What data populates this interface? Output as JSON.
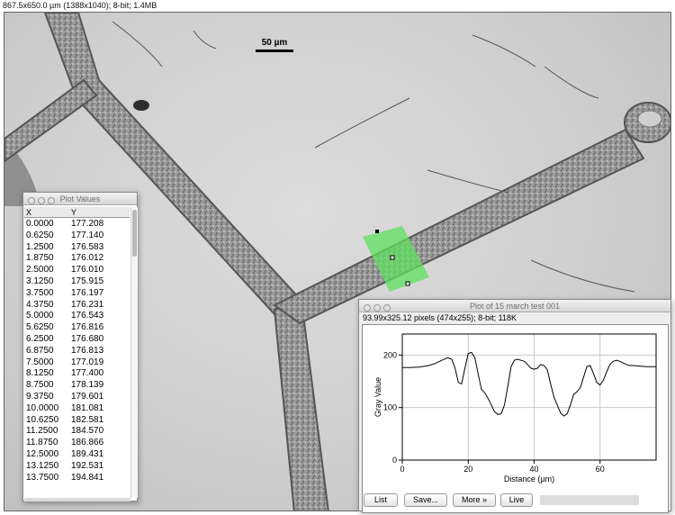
{
  "main_window": {
    "info": "867.5x650.0 µm (1388x1040); 8-bit; 1.4MB",
    "scale_bar_label": "50 µm"
  },
  "plot_values_window": {
    "title": "Plot Values",
    "columns": [
      "X",
      "Y"
    ],
    "rows": [
      [
        "0.0000",
        "177.208"
      ],
      [
        "0.6250",
        "177.140"
      ],
      [
        "1.2500",
        "176.583"
      ],
      [
        "1.8750",
        "176.012"
      ],
      [
        "2.5000",
        "176.010"
      ],
      [
        "3.1250",
        "175.915"
      ],
      [
        "3.7500",
        "176.197"
      ],
      [
        "4.3750",
        "176.231"
      ],
      [
        "5.0000",
        "176.543"
      ],
      [
        "5.6250",
        "176.816"
      ],
      [
        "6.2500",
        "176.680"
      ],
      [
        "6.8750",
        "176.813"
      ],
      [
        "7.5000",
        "177.019"
      ],
      [
        "8.1250",
        "177.400"
      ],
      [
        "8.7500",
        "178.139"
      ],
      [
        "9.3750",
        "179.601"
      ],
      [
        "10.0000",
        "181.081"
      ],
      [
        "10.6250",
        "182.581"
      ],
      [
        "11.2500",
        "184.570"
      ],
      [
        "11.8750",
        "186.866"
      ],
      [
        "12.5000",
        "189.431"
      ],
      [
        "13.1250",
        "192.531"
      ],
      [
        "13.7500",
        "194.841"
      ]
    ]
  },
  "plot_window": {
    "title": "Plot of 15 march  test 001",
    "info": "93.99x325.12 pixels (474x255); 8-bit; 118K",
    "buttons": {
      "list": "List",
      "save": "Save...",
      "more": "More »",
      "live": "Live"
    }
  },
  "chart_data": {
    "type": "line",
    "title": "",
    "xlabel": "Distance (µm)",
    "ylabel": "Gray Value",
    "xlim": [
      0,
      77
    ],
    "ylim": [
      0,
      240
    ],
    "xticks": [
      0,
      20,
      40,
      60
    ],
    "yticks": [
      0,
      100,
      200
    ],
    "grid": true,
    "series": [
      {
        "x": [
          0,
          2,
          5,
          8,
          10,
          12,
          13.75,
          15,
          16,
          17,
          18,
          19,
          20,
          21,
          22,
          23,
          24,
          25,
          26,
          27,
          28,
          29,
          30,
          31,
          32,
          33,
          34,
          35,
          36,
          37,
          38,
          39,
          40,
          41,
          42,
          43,
          44,
          45,
          46,
          47,
          48,
          49,
          50,
          51,
          52,
          53,
          54,
          55,
          56,
          57,
          58,
          59,
          60,
          61,
          62,
          63,
          64,
          65,
          66,
          67,
          68,
          69,
          70,
          72,
          74,
          76,
          77
        ],
        "y": [
          176,
          176,
          177,
          180,
          184,
          190,
          195,
          192,
          175,
          148,
          145,
          175,
          203,
          205,
          195,
          165,
          135,
          128,
          118,
          105,
          92,
          87,
          88,
          105,
          140,
          178,
          190,
          192,
          190,
          188,
          182,
          175,
          173,
          175,
          182,
          180,
          172,
          145,
          120,
          105,
          90,
          84,
          88,
          105,
          125,
          130,
          138,
          158,
          178,
          180,
          165,
          148,
          143,
          152,
          168,
          182,
          188,
          190,
          188,
          185,
          182,
          180,
          180,
          179,
          178,
          178,
          178
        ]
      }
    ]
  }
}
